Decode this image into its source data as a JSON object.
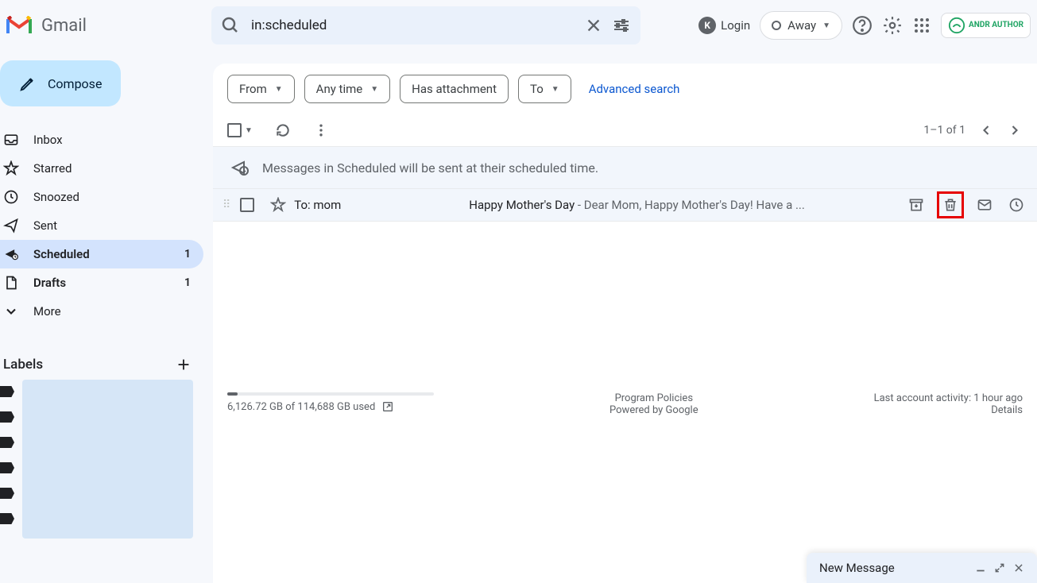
{
  "app": {
    "name": "Gmail"
  },
  "search": {
    "value": "in:scheduled"
  },
  "header": {
    "login_label": "Login",
    "status_label": "Away",
    "account_badge": "ANDR AUTHOR"
  },
  "compose": {
    "label": "Compose"
  },
  "nav": {
    "inbox": "Inbox",
    "starred": "Starred",
    "snoozed": "Snoozed",
    "sent": "Sent",
    "scheduled": "Scheduled",
    "scheduled_count": "1",
    "drafts": "Drafts",
    "drafts_count": "1",
    "more": "More"
  },
  "labels": {
    "title": "Labels"
  },
  "filters": {
    "from": "From",
    "anytime": "Any time",
    "has_attachment": "Has attachment",
    "to": "To",
    "advanced": "Advanced search"
  },
  "toolbar": {
    "range": "1–1 of 1"
  },
  "info_bar": "Messages in Scheduled will be sent at their scheduled time.",
  "email": {
    "recipient": "To: mom",
    "subject": "Happy Mother's Day",
    "snippet": " - Dear Mom, Happy Mother's Day! Have a ..."
  },
  "footer": {
    "storage": "6,126.72 GB of 114,688 GB used",
    "policies": "Program Policies",
    "powered": "Powered by Google",
    "activity": "Last account activity: 1 hour ago",
    "details": "Details"
  },
  "popup": {
    "title": "New Message"
  }
}
